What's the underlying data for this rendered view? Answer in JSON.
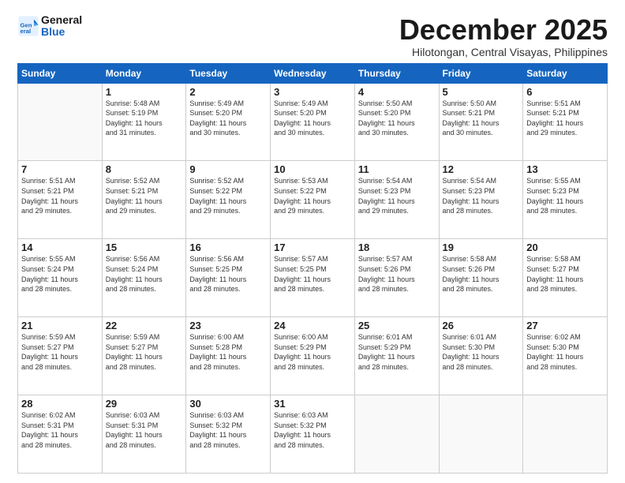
{
  "logo": {
    "line1": "General",
    "line2": "Blue"
  },
  "title": "December 2025",
  "subtitle": "Hilotongan, Central Visayas, Philippines",
  "weekdays": [
    "Sunday",
    "Monday",
    "Tuesday",
    "Wednesday",
    "Thursday",
    "Friday",
    "Saturday"
  ],
  "weeks": [
    [
      {
        "day": "",
        "info": ""
      },
      {
        "day": "1",
        "info": "Sunrise: 5:48 AM\nSunset: 5:19 PM\nDaylight: 11 hours\nand 31 minutes."
      },
      {
        "day": "2",
        "info": "Sunrise: 5:49 AM\nSunset: 5:20 PM\nDaylight: 11 hours\nand 30 minutes."
      },
      {
        "day": "3",
        "info": "Sunrise: 5:49 AM\nSunset: 5:20 PM\nDaylight: 11 hours\nand 30 minutes."
      },
      {
        "day": "4",
        "info": "Sunrise: 5:50 AM\nSunset: 5:20 PM\nDaylight: 11 hours\nand 30 minutes."
      },
      {
        "day": "5",
        "info": "Sunrise: 5:50 AM\nSunset: 5:21 PM\nDaylight: 11 hours\nand 30 minutes."
      },
      {
        "day": "6",
        "info": "Sunrise: 5:51 AM\nSunset: 5:21 PM\nDaylight: 11 hours\nand 29 minutes."
      }
    ],
    [
      {
        "day": "7",
        "info": "Sunrise: 5:51 AM\nSunset: 5:21 PM\nDaylight: 11 hours\nand 29 minutes."
      },
      {
        "day": "8",
        "info": "Sunrise: 5:52 AM\nSunset: 5:21 PM\nDaylight: 11 hours\nand 29 minutes."
      },
      {
        "day": "9",
        "info": "Sunrise: 5:52 AM\nSunset: 5:22 PM\nDaylight: 11 hours\nand 29 minutes."
      },
      {
        "day": "10",
        "info": "Sunrise: 5:53 AM\nSunset: 5:22 PM\nDaylight: 11 hours\nand 29 minutes."
      },
      {
        "day": "11",
        "info": "Sunrise: 5:54 AM\nSunset: 5:23 PM\nDaylight: 11 hours\nand 29 minutes."
      },
      {
        "day": "12",
        "info": "Sunrise: 5:54 AM\nSunset: 5:23 PM\nDaylight: 11 hours\nand 28 minutes."
      },
      {
        "day": "13",
        "info": "Sunrise: 5:55 AM\nSunset: 5:23 PM\nDaylight: 11 hours\nand 28 minutes."
      }
    ],
    [
      {
        "day": "14",
        "info": "Sunrise: 5:55 AM\nSunset: 5:24 PM\nDaylight: 11 hours\nand 28 minutes."
      },
      {
        "day": "15",
        "info": "Sunrise: 5:56 AM\nSunset: 5:24 PM\nDaylight: 11 hours\nand 28 minutes."
      },
      {
        "day": "16",
        "info": "Sunrise: 5:56 AM\nSunset: 5:25 PM\nDaylight: 11 hours\nand 28 minutes."
      },
      {
        "day": "17",
        "info": "Sunrise: 5:57 AM\nSunset: 5:25 PM\nDaylight: 11 hours\nand 28 minutes."
      },
      {
        "day": "18",
        "info": "Sunrise: 5:57 AM\nSunset: 5:26 PM\nDaylight: 11 hours\nand 28 minutes."
      },
      {
        "day": "19",
        "info": "Sunrise: 5:58 AM\nSunset: 5:26 PM\nDaylight: 11 hours\nand 28 minutes."
      },
      {
        "day": "20",
        "info": "Sunrise: 5:58 AM\nSunset: 5:27 PM\nDaylight: 11 hours\nand 28 minutes."
      }
    ],
    [
      {
        "day": "21",
        "info": "Sunrise: 5:59 AM\nSunset: 5:27 PM\nDaylight: 11 hours\nand 28 minutes."
      },
      {
        "day": "22",
        "info": "Sunrise: 5:59 AM\nSunset: 5:27 PM\nDaylight: 11 hours\nand 28 minutes."
      },
      {
        "day": "23",
        "info": "Sunrise: 6:00 AM\nSunset: 5:28 PM\nDaylight: 11 hours\nand 28 minutes."
      },
      {
        "day": "24",
        "info": "Sunrise: 6:00 AM\nSunset: 5:29 PM\nDaylight: 11 hours\nand 28 minutes."
      },
      {
        "day": "25",
        "info": "Sunrise: 6:01 AM\nSunset: 5:29 PM\nDaylight: 11 hours\nand 28 minutes."
      },
      {
        "day": "26",
        "info": "Sunrise: 6:01 AM\nSunset: 5:30 PM\nDaylight: 11 hours\nand 28 minutes."
      },
      {
        "day": "27",
        "info": "Sunrise: 6:02 AM\nSunset: 5:30 PM\nDaylight: 11 hours\nand 28 minutes."
      }
    ],
    [
      {
        "day": "28",
        "info": "Sunrise: 6:02 AM\nSunset: 5:31 PM\nDaylight: 11 hours\nand 28 minutes."
      },
      {
        "day": "29",
        "info": "Sunrise: 6:03 AM\nSunset: 5:31 PM\nDaylight: 11 hours\nand 28 minutes."
      },
      {
        "day": "30",
        "info": "Sunrise: 6:03 AM\nSunset: 5:32 PM\nDaylight: 11 hours\nand 28 minutes."
      },
      {
        "day": "31",
        "info": "Sunrise: 6:03 AM\nSunset: 5:32 PM\nDaylight: 11 hours\nand 28 minutes."
      },
      {
        "day": "",
        "info": ""
      },
      {
        "day": "",
        "info": ""
      },
      {
        "day": "",
        "info": ""
      }
    ]
  ],
  "colors": {
    "header_bg": "#1565c0",
    "header_text": "#ffffff",
    "border": "#cccccc",
    "empty_bg": "#f9f9f9"
  }
}
